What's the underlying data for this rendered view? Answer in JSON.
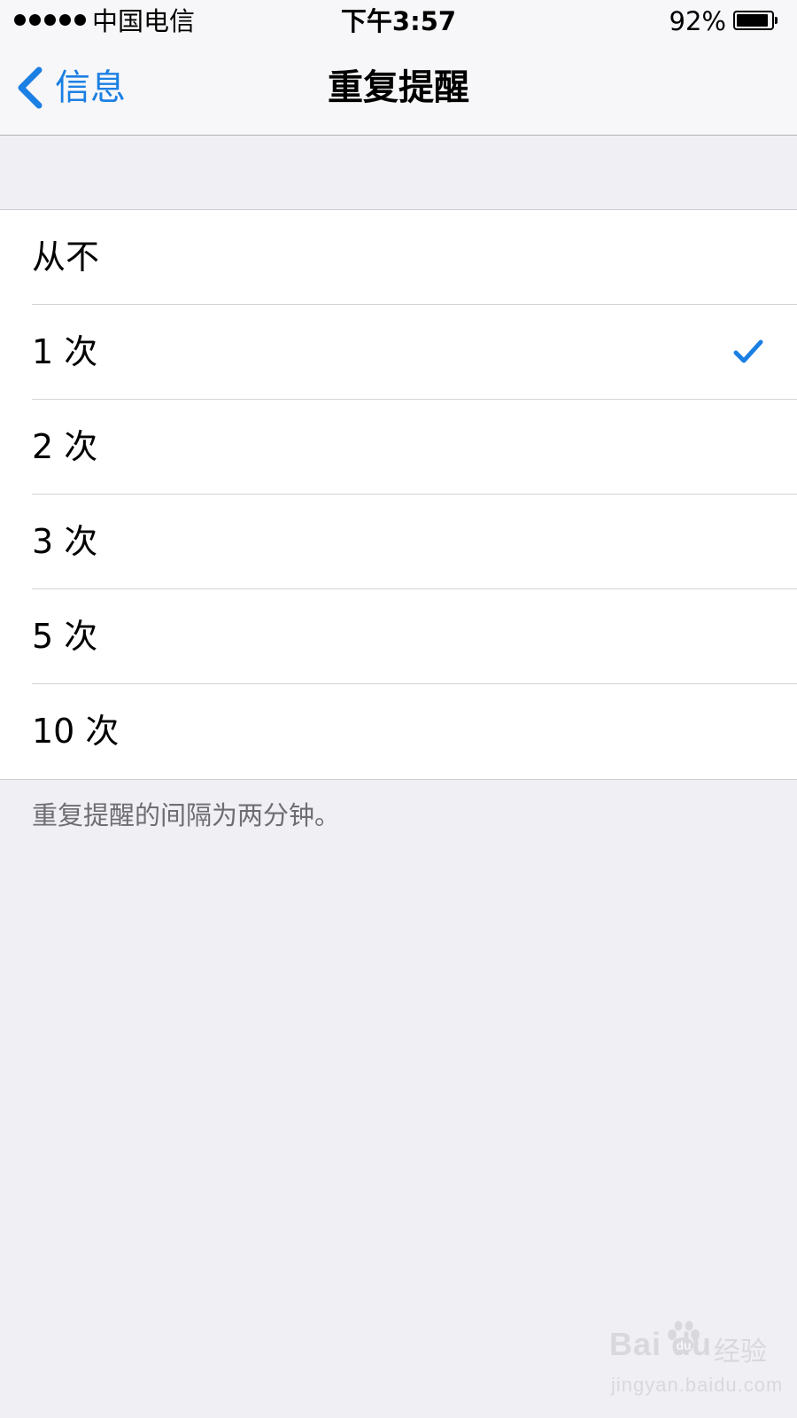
{
  "status_bar": {
    "signal_dots": 5,
    "carrier": "中国电信",
    "time": "下午3:57",
    "battery_percent_text": "92%",
    "battery_level": 0.92
  },
  "nav": {
    "back_label": "信息",
    "title": "重复提醒"
  },
  "options": [
    {
      "label": "从不",
      "selected": false
    },
    {
      "label": "1 次",
      "selected": true
    },
    {
      "label": "2 次",
      "selected": false
    },
    {
      "label": "3 次",
      "selected": false
    },
    {
      "label": "5 次",
      "selected": false
    },
    {
      "label": "10 次",
      "selected": false
    }
  ],
  "footer_note": "重复提醒的间隔为两分钟。",
  "watermark": {
    "brand": "Bai du",
    "cn": "经验",
    "url": "jingyan.baidu.com"
  },
  "colors": {
    "accent": "#1B7FE3",
    "background": "#EFEFF4",
    "nav_background": "#F7F7F9",
    "cell_background": "#FFFFFF",
    "footer_text": "#6D6D72"
  }
}
